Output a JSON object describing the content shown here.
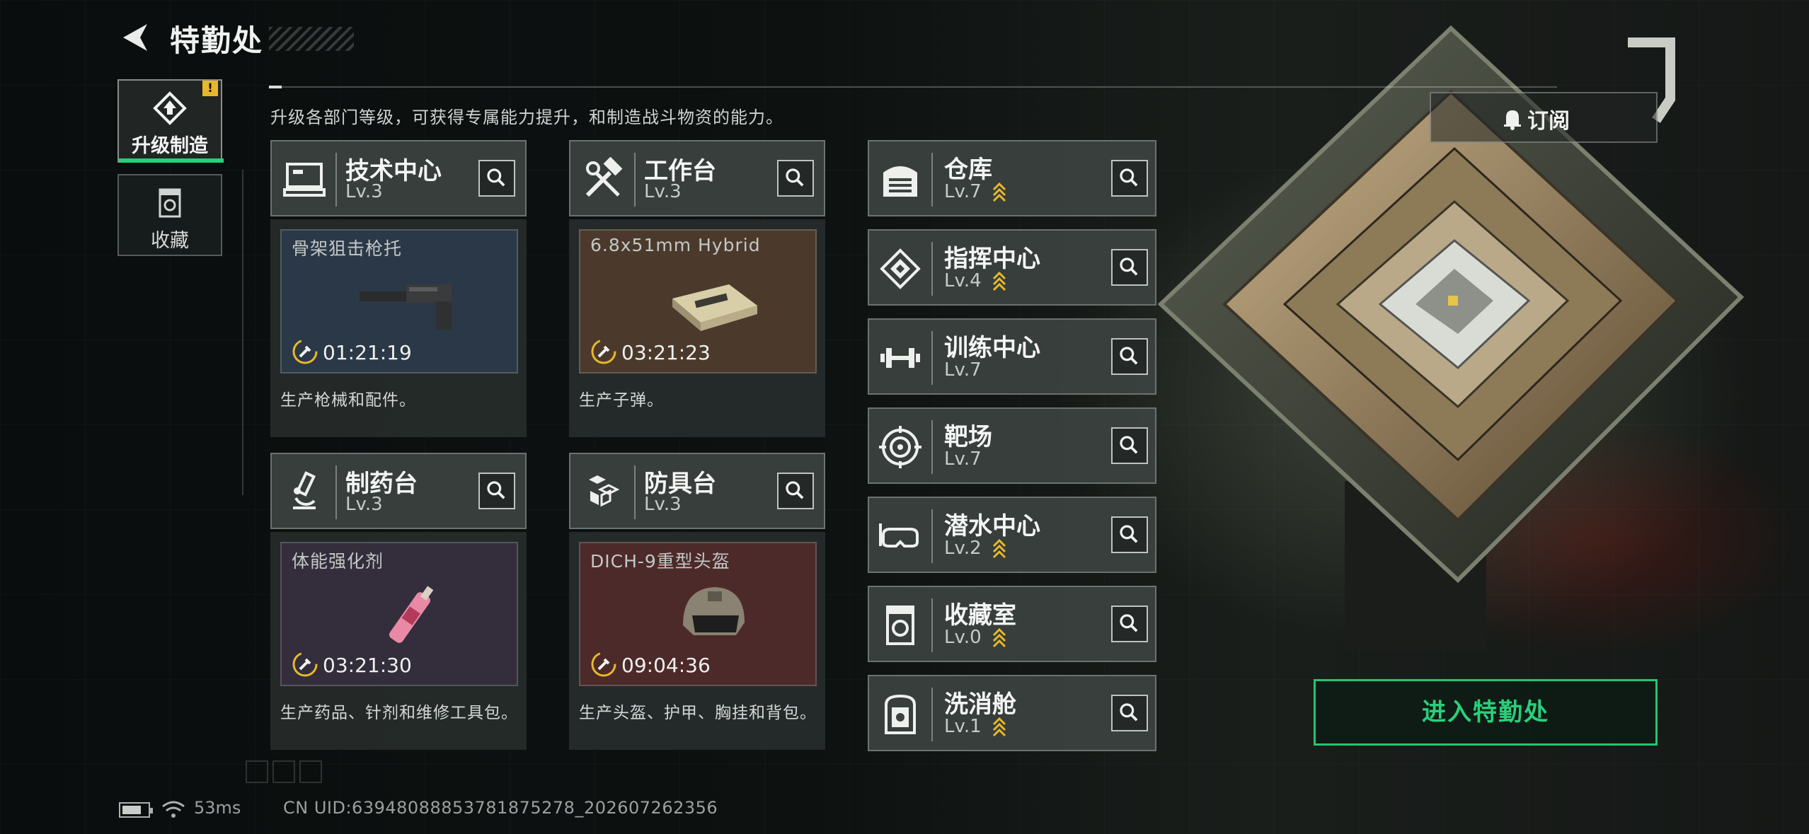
{
  "header": {
    "title": "特勤处"
  },
  "nav": {
    "tabs": [
      {
        "label": "升级制造",
        "alert": "!"
      },
      {
        "label": "收藏"
      }
    ]
  },
  "page": {
    "description": "升级各部门等级，可获得专属能力提升，和制造战斗物资的能力。"
  },
  "departments": [
    {
      "name": "技术中心",
      "level": "Lv.3",
      "icon": "computer-icon",
      "product": "骨架狙击枪托",
      "timer": "01:21:19",
      "desc": "生产枪械和配件。",
      "panel_color": "#2b3847"
    },
    {
      "name": "工作台",
      "level": "Lv.3",
      "icon": "hammer-wrench-icon",
      "product": "6.8x51mm Hybrid",
      "timer": "03:21:23",
      "desc": "生产子弹。",
      "panel_color": "#4b3a2c"
    },
    {
      "name": "制药台",
      "level": "Lv.3",
      "icon": "microscope-icon",
      "product": "体能强化剂",
      "timer": "03:21:30",
      "desc": "生产药品、针剂和维修工具包。",
      "panel_color": "#332d3c"
    },
    {
      "name": "防具台",
      "level": "Lv.3",
      "icon": "armor-blocks-icon",
      "product": "DICH-9重型头盔",
      "timer": "09:04:36",
      "desc": "生产头盔、护甲、胸挂和背包。",
      "panel_color": "#4d2a2a"
    }
  ],
  "facilities": [
    {
      "name": "仓库",
      "level": "Lv.7",
      "upgradable": true,
      "icon": "warehouse-icon"
    },
    {
      "name": "指挥中心",
      "level": "Lv.4",
      "upgradable": true,
      "icon": "command-chip-icon"
    },
    {
      "name": "训练中心",
      "level": "Lv.7",
      "upgradable": false,
      "icon": "dumbbell-icon"
    },
    {
      "name": "靶场",
      "level": "Lv.7",
      "upgradable": false,
      "icon": "target-icon"
    },
    {
      "name": "潜水中心",
      "level": "Lv.2",
      "upgradable": true,
      "icon": "diving-mask-icon"
    },
    {
      "name": "收藏室",
      "level": "Lv.0",
      "upgradable": true,
      "icon": "collection-icon"
    },
    {
      "name": "洗消舱",
      "level": "Lv.1",
      "upgradable": true,
      "icon": "decontamination-icon"
    }
  ],
  "actions": {
    "subscribe": "订阅",
    "enter": "进入特勤处"
  },
  "status": {
    "ping": "53ms",
    "uid": "CN UID:63948088853781875278_202607262356"
  },
  "colors": {
    "accent": "#25c572",
    "upgrade": "#e8b82a"
  }
}
